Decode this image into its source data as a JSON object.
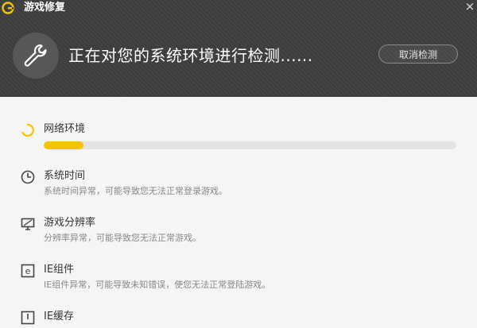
{
  "app": {
    "title": "游戏修复",
    "logo_icon": "app-logo-icon",
    "close_icon": "close-icon"
  },
  "header": {
    "status_text": "正在对您的系统环境进行检测......",
    "cancel_label": "取消检测",
    "tool_icon": "wrench-icon"
  },
  "checks": [
    {
      "title": "网络环境",
      "desc": "",
      "icon": "loading-spinner-icon",
      "state": "checking",
      "progress": 0.097
    },
    {
      "title": "系统时间",
      "desc": "系统时间异常，可能导致您无法正常登录游戏。",
      "icon": "clock-icon"
    },
    {
      "title": "游戏分辨率",
      "desc": "分辨率异常，可能导致您无法正常游戏。",
      "icon": "monitor-icon"
    },
    {
      "title": "IE组件",
      "desc": "IE组件异常，可能导致未知错误，使您无法正常登陆游戏。",
      "icon": "ie-icon"
    },
    {
      "title": "IE缓存",
      "desc": "",
      "icon": "cache-icon"
    }
  ],
  "colors": {
    "accent": "#f5c400",
    "header_bg": "#3c3c3c",
    "content_bg": "#f5f5f5"
  }
}
